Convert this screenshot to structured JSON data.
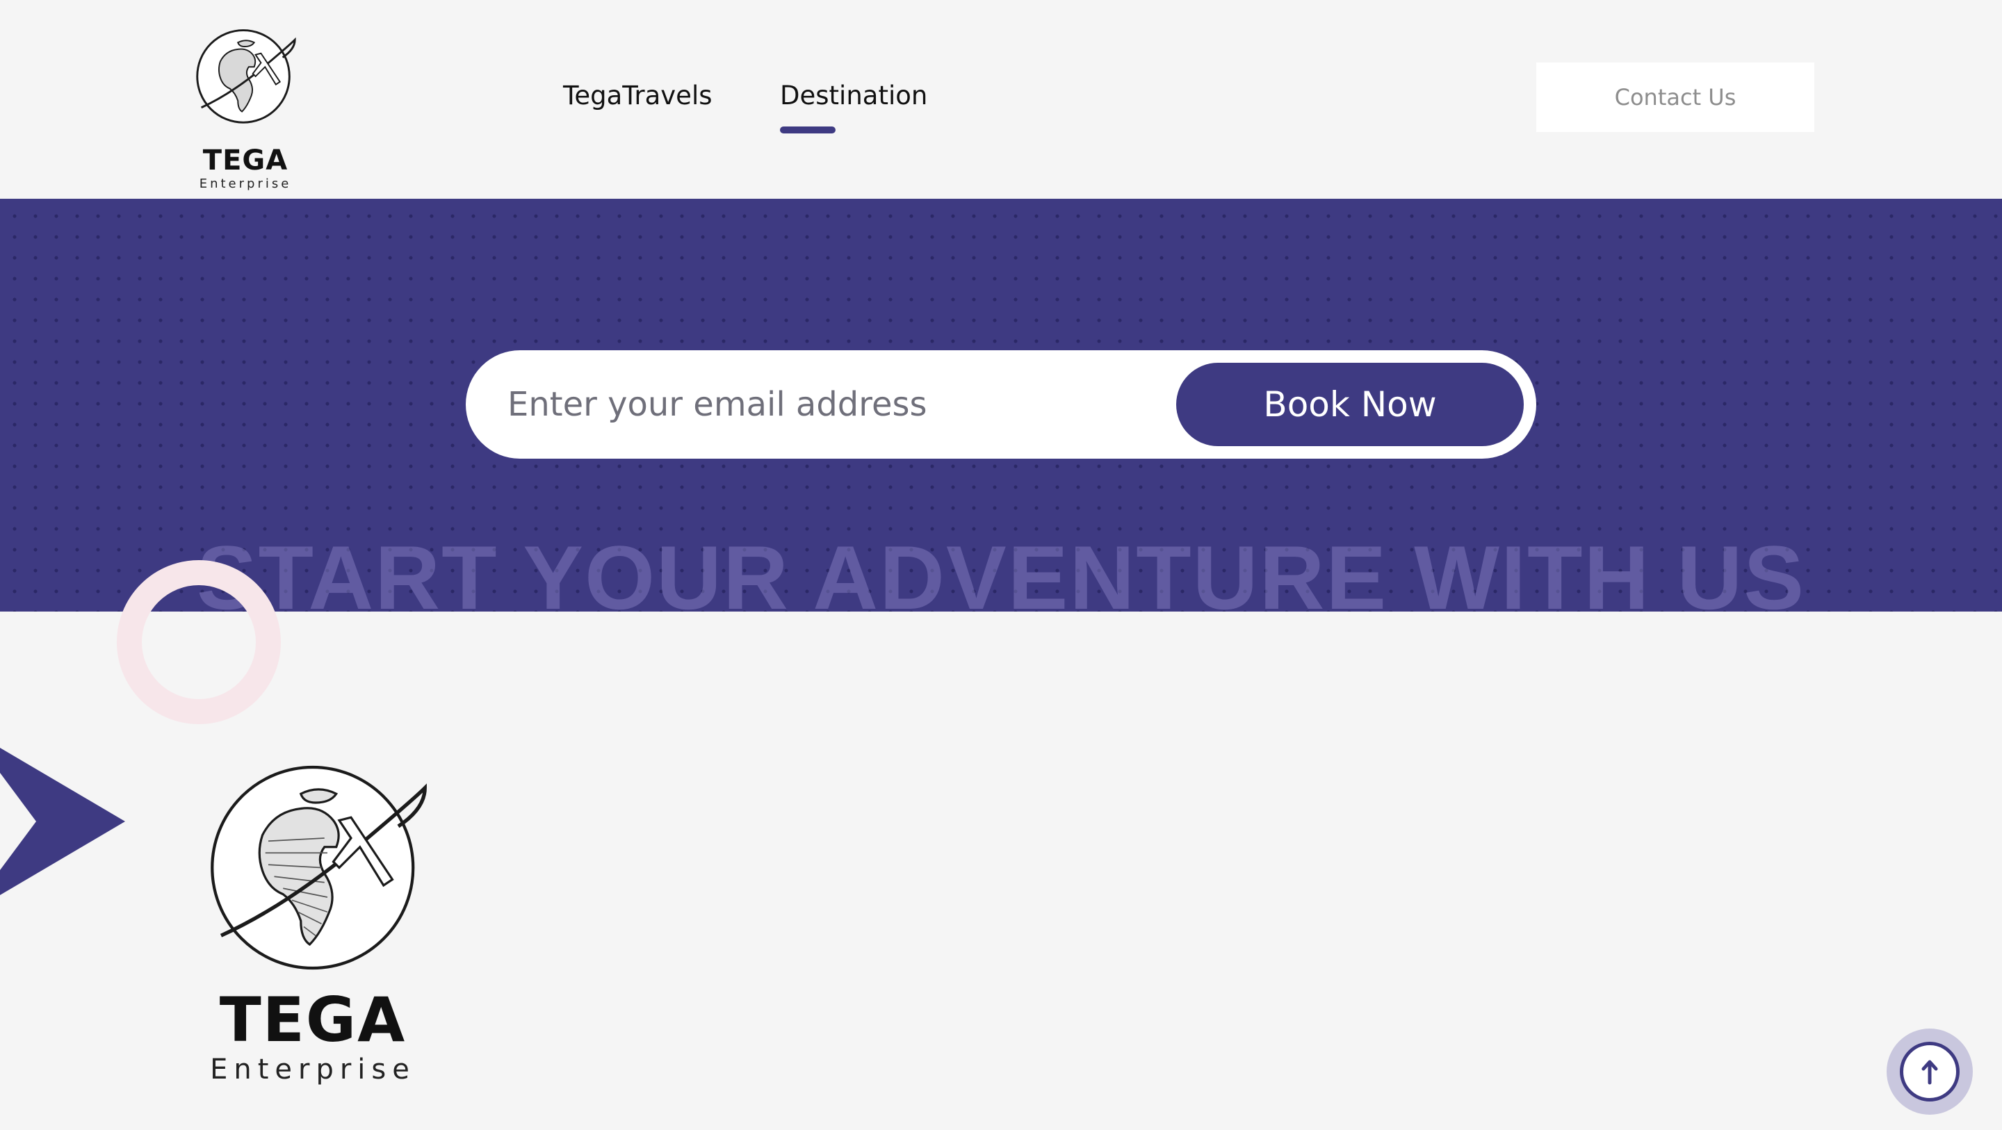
{
  "header": {
    "logo": {
      "brand": "TEGA",
      "subtitle": "Enterprise",
      "icon": "globe-airplane-icon"
    },
    "nav": {
      "items": [
        {
          "label": "TegaTravels",
          "active": false
        },
        {
          "label": "Destination",
          "active": true
        }
      ]
    },
    "contact_button": {
      "label": "Contact Us"
    }
  },
  "banner": {
    "email_input": {
      "placeholder": "Enter your email address",
      "value": ""
    },
    "book_button": {
      "label": "Book Now"
    },
    "headline": "START YOUR ADVENTURE WITH US"
  },
  "main": {
    "logo": {
      "brand": "TEGA",
      "subtitle": "Enterprise",
      "icon": "globe-airplane-icon"
    }
  },
  "scroll_top": {
    "icon": "arrow-up-icon"
  },
  "colors": {
    "accent": "#3e3a82",
    "background": "#f5f5f5",
    "contact_text": "#8d8d8d",
    "ring_decoration": "#f7e6ea"
  }
}
